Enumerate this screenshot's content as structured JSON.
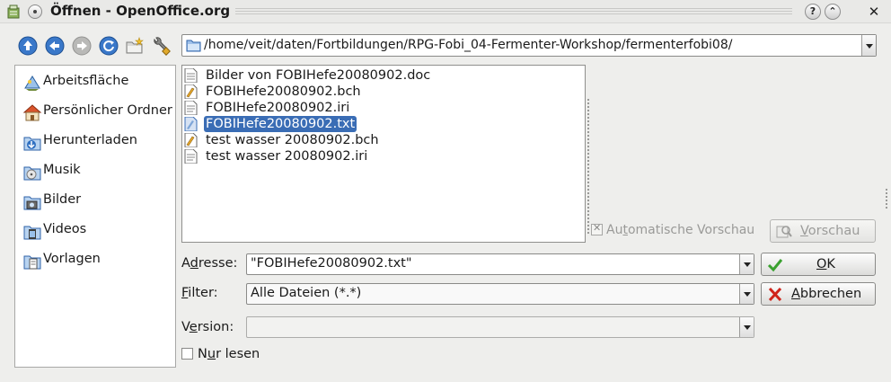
{
  "window": {
    "title": "Öffnen - OpenOffice.org",
    "help_glyph": "?",
    "up_glyph": "⌃",
    "close_glyph": "✕"
  },
  "toolbar": {
    "icons": [
      "up-arrow-icon",
      "back-arrow-icon",
      "forward-arrow-icon",
      "reload-icon",
      "new-folder-icon",
      "settings-wrench-icon"
    ],
    "path": "/home/veit/daten/Fortbildungen/RPG-Fobi_04-Fermenter-Workshop/fermenterfobi08/"
  },
  "places": [
    {
      "label": "Arbeitsfläche",
      "icon": "desktop-icon"
    },
    {
      "label": "Persönlicher Ordner",
      "icon": "home-folder-icon"
    },
    {
      "label": "Herunterladen",
      "icon": "downloads-folder-icon"
    },
    {
      "label": "Musik",
      "icon": "music-folder-icon"
    },
    {
      "label": "Bilder",
      "icon": "pictures-folder-icon"
    },
    {
      "label": "Videos",
      "icon": "videos-folder-icon"
    },
    {
      "label": "Vorlagen",
      "icon": "templates-folder-icon"
    }
  ],
  "files": [
    {
      "name": "Bilder von FOBIHefe20080902.doc",
      "icon": "document-file-icon",
      "selected": false
    },
    {
      "name": "FOBIHefe20080902.bch",
      "icon": "script-file-icon",
      "selected": false
    },
    {
      "name": "FOBIHefe20080902.iri",
      "icon": "text-file-icon",
      "selected": false
    },
    {
      "name": "FOBIHefe20080902.txt",
      "icon": "text-file-icon",
      "selected": true
    },
    {
      "name": "test wasser 20080902.bch",
      "icon": "script-file-icon",
      "selected": false
    },
    {
      "name": "test wasser 20080902.iri",
      "icon": "text-file-icon",
      "selected": false
    }
  ],
  "preview": {
    "auto_label_pre": "Au",
    "auto_label_mnemonic": "t",
    "auto_label_post": "omatische Vorschau",
    "button_mnemonic": "V",
    "button_rest": "orschau"
  },
  "address": {
    "label_pre": "A",
    "label_mnemonic": "d",
    "label_post": "resse:",
    "value": "\"FOBIHefe20080902.txt\""
  },
  "filter": {
    "label_mnemonic": "F",
    "label_post": "ilter:",
    "value": "Alle Dateien (*.*)"
  },
  "version": {
    "label_pre": "V",
    "label_mnemonic": "e",
    "label_post": "rsion:",
    "value": ""
  },
  "readonly": {
    "label_pre": "N",
    "label_mnemonic": "u",
    "label_post": "r lesen"
  },
  "buttons": {
    "ok_mnemonic": "O",
    "ok_rest": "K",
    "cancel_mnemonic": "A",
    "cancel_rest": "bbrechen"
  },
  "colors": {
    "selection": "#3a6db5",
    "toolbar_blue": "#3a78c9",
    "ok_check": "#3aa12f",
    "cancel_x": "#d0231a"
  }
}
